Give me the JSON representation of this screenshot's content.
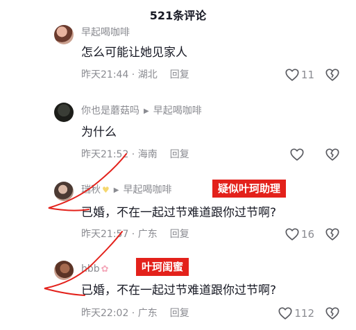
{
  "header": {
    "title": "521条评论"
  },
  "comments": [
    {
      "user": "早起喝咖啡",
      "text": "怎么可能让她见家人",
      "time": "昨天21:44",
      "location": "湖北",
      "reply": "回复",
      "likes": "11"
    },
    {
      "user": "你也是蘑菇吗",
      "reply_to": "早起喝咖啡",
      "text": "为什么",
      "time": "昨天21:52",
      "location": "海南",
      "reply": "回复",
      "likes": ""
    },
    {
      "user": "瑞秋",
      "reply_to": "早起喝咖啡",
      "text": "已婚，不在一起过节难道跟你过节啊?",
      "time": "昨天21:57",
      "location": "广东",
      "reply": "回复",
      "likes": "16"
    },
    {
      "user": "hbb",
      "text": "已婚，不在一起过节难道跟你过节啊?",
      "time": "昨天22:02",
      "location": "广东",
      "reply": "回复",
      "likes": "112"
    }
  ],
  "annotations": {
    "tag1": "疑似叶珂助理",
    "tag2": "叶珂闺蜜"
  },
  "colors": {
    "accent_red": "#e3211b",
    "muted_text": "#8a8b91",
    "main_text": "#161823"
  },
  "icons": {
    "like": "heart-outline-icon",
    "dislike": "broken-heart-icon",
    "reply_arrow": "triangle-right-icon"
  }
}
